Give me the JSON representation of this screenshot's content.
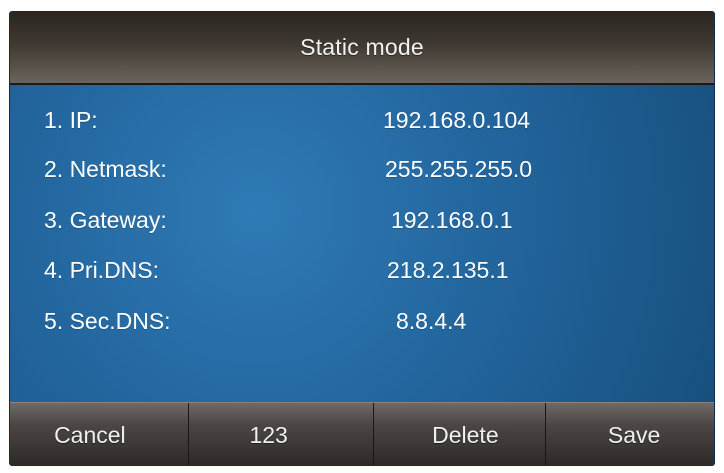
{
  "header": {
    "title": "Static mode"
  },
  "settings": {
    "rows": [
      {
        "label": "1. IP:",
        "value": "192.168.0.104"
      },
      {
        "label": "2. Netmask:",
        "value": "255.255.255.0"
      },
      {
        "label": "3. Gateway:",
        "value": "192.168.0.1"
      },
      {
        "label": "4.  Pri.DNS:",
        "value": "218.2.135.1"
      },
      {
        "label": "5.  Sec.DNS:",
        "value": "8.8.4.4"
      }
    ]
  },
  "softkeys": {
    "items": [
      {
        "label": "Cancel"
      },
      {
        "label": "123"
      },
      {
        "label": "Delete"
      },
      {
        "label": "Save"
      }
    ]
  }
}
